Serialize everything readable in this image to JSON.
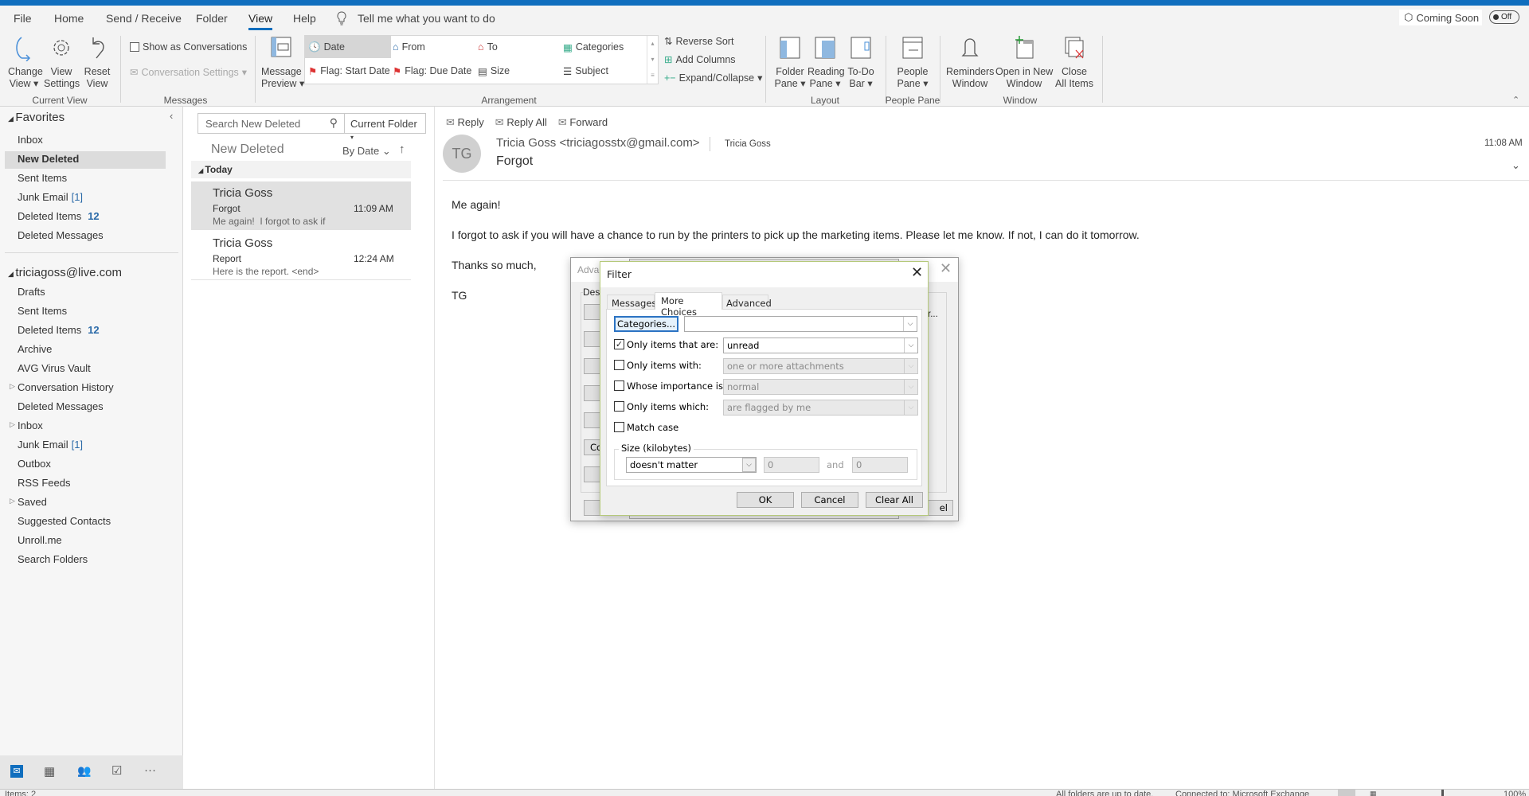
{
  "menu": {
    "tabs": [
      "File",
      "Home",
      "Send / Receive",
      "Folder",
      "View",
      "Help"
    ],
    "active": "View",
    "tell_me": "Tell me what you want to do",
    "coming_soon": "Coming Soon",
    "toggle": "Off"
  },
  "ribbon": {
    "current_view": {
      "label": "Current View",
      "change_view": [
        "Change",
        "View"
      ],
      "view_settings": [
        "View",
        "Settings"
      ],
      "reset_view": [
        "Reset",
        "View"
      ]
    },
    "messages": {
      "label": "Messages",
      "show_as_conversations": "Show as Conversations",
      "conversation_settings": "Conversation Settings"
    },
    "arrangement": {
      "label": "Arrangement",
      "message_preview": [
        "Message",
        "Preview"
      ],
      "items": [
        "Date",
        "From",
        "To",
        "Categories",
        "Flag: Start Date",
        "Flag: Due Date",
        "Size",
        "Subject"
      ],
      "selected": "Date",
      "reverse_sort": "Reverse Sort",
      "add_columns": "Add Columns",
      "expand_collapse": "Expand/Collapse"
    },
    "layout": {
      "label": "Layout",
      "folder_pane": [
        "Folder",
        "Pane"
      ],
      "reading_pane": [
        "Reading",
        "Pane"
      ],
      "todo_bar": [
        "To-Do",
        "Bar"
      ]
    },
    "people_pane": {
      "label": "People Pane",
      "people_pane": [
        "People",
        "Pane"
      ]
    },
    "window": {
      "label": "Window",
      "reminders": [
        "Reminders",
        "Window"
      ],
      "open_new": [
        "Open in New",
        "Window"
      ],
      "close_all": [
        "Close",
        "All Items"
      ]
    }
  },
  "folders": {
    "favorites_header": "Favorites",
    "favorites": [
      {
        "name": "Inbox"
      },
      {
        "name": "New Deleted",
        "selected": true
      },
      {
        "name": "Sent Items"
      },
      {
        "name": "Junk Email",
        "count": "[1]"
      },
      {
        "name": "Deleted Items",
        "count": "12"
      },
      {
        "name": "Deleted Messages"
      }
    ],
    "account": "triciagoss@live.com",
    "account_folders": [
      {
        "name": "Drafts"
      },
      {
        "name": "Sent Items"
      },
      {
        "name": "Deleted Items",
        "count": "12"
      },
      {
        "name": "Archive"
      },
      {
        "name": "AVG Virus Vault"
      },
      {
        "name": "Conversation History",
        "expandable": true
      },
      {
        "name": "Deleted Messages"
      },
      {
        "name": "Inbox",
        "expandable": true
      },
      {
        "name": "Junk Email",
        "count": "[1]"
      },
      {
        "name": "Outbox"
      },
      {
        "name": "RSS Feeds"
      },
      {
        "name": "Saved",
        "expandable": true
      },
      {
        "name": "Suggested Contacts"
      },
      {
        "name": "Unroll.me"
      },
      {
        "name": "Search Folders"
      }
    ],
    "nav_icons": [
      "mail-icon",
      "calendar-icon",
      "people-icon",
      "tasks-icon",
      "more-icon"
    ]
  },
  "message_list": {
    "search_placeholder": "Search New Deleted",
    "scope": "Current Folder",
    "folder_title": "New Deleted",
    "sort": "By Date",
    "group": "Today",
    "items": [
      {
        "sender": "Tricia Goss",
        "subject": "Forgot",
        "preview": "Me again!  I forgot to ask if",
        "time": "11:09 AM",
        "selected": true
      },
      {
        "sender": "Tricia Goss",
        "subject": "Report",
        "preview": "Here is the report. <end>",
        "time": "12:24 AM"
      }
    ]
  },
  "reading_pane": {
    "actions": [
      "Reply",
      "Reply All",
      "Forward"
    ],
    "avatar": "TG",
    "from": "Tricia Goss <triciagosstx@gmail.com>",
    "to": "Tricia Goss",
    "subject": "Forgot",
    "time": "11:08 AM",
    "body": [
      "Me again!",
      "I forgot to ask if you will have a chance to run by the printers to pick up the marketing items. Please let me know. If not, I can do it tomorrow.",
      "Thanks so much,",
      "TG"
    ]
  },
  "advanced_dialog": {
    "title": "Adva",
    "group": "Desc",
    "button_fragment": "Co",
    "right_fragment": "r...",
    "cancel_fragment": "el"
  },
  "filter_dialog": {
    "title": "Filter",
    "tabs": [
      "Messages",
      "More Choices",
      "Advanced"
    ],
    "active_tab": "More Choices",
    "categories_button": "Categories...",
    "categories_value": "",
    "rows": [
      {
        "label": "Only items that are:",
        "checked": true,
        "value": "unread",
        "enabled": true
      },
      {
        "label": "Only items with:",
        "checked": false,
        "value": "one or more attachments",
        "enabled": false
      },
      {
        "label": "Whose importance is:",
        "checked": false,
        "value": "normal",
        "enabled": false
      },
      {
        "label": "Only items which:",
        "checked": false,
        "value": "are flagged by me",
        "enabled": false
      }
    ],
    "match_case": {
      "label": "Match case",
      "checked": false
    },
    "size": {
      "legend": "Size (kilobytes)",
      "condition": "doesn't matter",
      "min": "0",
      "and": "and",
      "max": "0"
    },
    "buttons": {
      "ok": "OK",
      "cancel": "Cancel",
      "clear_all": "Clear All"
    }
  },
  "status_bar": {
    "items": "Items: 2",
    "sync": "All folders are up to date.",
    "connection": "Connected to: Microsoft Exchange",
    "zoom": "100%"
  },
  "colors": {
    "accent": "#106ebe",
    "count": "#2b6aa8",
    "selected_bg": "#e1e1e1"
  }
}
